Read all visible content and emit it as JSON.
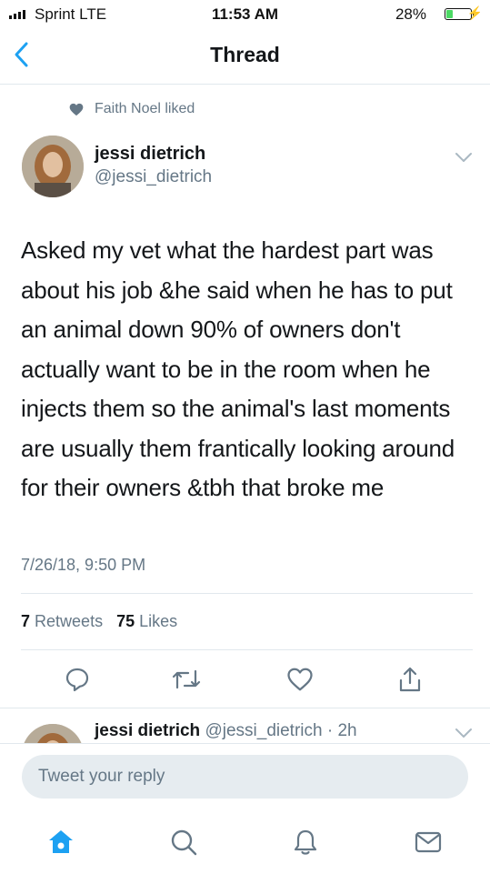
{
  "status_bar": {
    "carrier": "Sprint  LTE",
    "time": "11:53 AM",
    "battery_percent": "28%",
    "battery_level": 0.28
  },
  "nav": {
    "title": "Thread",
    "back_icon": "chevron-left-icon"
  },
  "social_context": {
    "text": "Faith Noel liked",
    "icon": "heart-icon"
  },
  "tweet": {
    "author_name": "jessi dietrich",
    "author_handle": "@jessi_dietrich",
    "text": "Asked my vet what the hardest part was about his job &he said when he has to put an animal down 90% of owners don't actually want to be in the room when he injects them so the animal's last moments are usually them frantically looking around for their owners &tbh that broke me",
    "timestamp": "7/26/18, 9:50 PM",
    "retweet_count": "7",
    "retweet_label": "Retweets",
    "like_count": "75",
    "like_label": "Likes"
  },
  "actions": [
    "reply-icon",
    "retweet-icon",
    "like-icon",
    "share-icon"
  ],
  "next_tweet": {
    "author_name": "jessi dietrich",
    "meta": "@jessi_dietrich · 2h"
  },
  "reply": {
    "placeholder": "Tweet your reply"
  },
  "tabs": [
    "home-icon",
    "search-icon",
    "notifications-icon",
    "messages-icon"
  ],
  "colors": {
    "accent": "#1da1f2",
    "text_primary": "#14171a",
    "text_secondary": "#657786",
    "divider": "#e1e8ed",
    "battery_fill": "#4cd964"
  }
}
